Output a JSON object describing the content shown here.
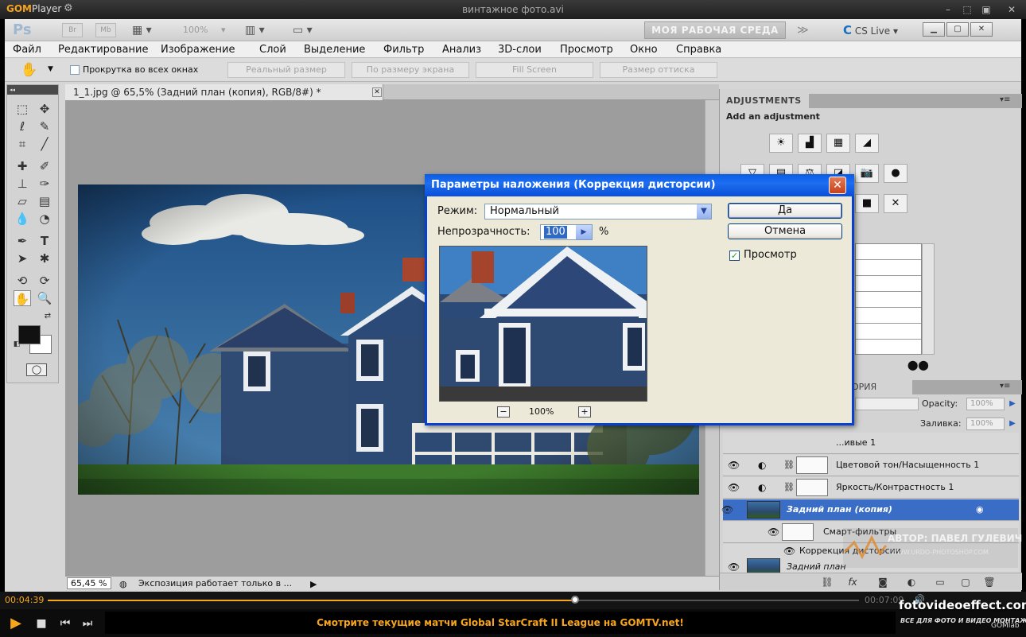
{
  "player": {
    "logo_gom": "GOM",
    "logo_player": "Player",
    "filename": "винтажное фото.avi",
    "current_time": "00:04:39",
    "total_time": "00:07:09",
    "progress_fraction": 0.65,
    "ticker": "Смотрите текущие матчи Global StarCraft II League на GOMTV.net!",
    "brand": "GOMlab"
  },
  "photoshop": {
    "app_logo": "Ps",
    "zoom_level": "100%",
    "workspace_button": "МОЯ РАБОЧАЯ СРЕДА",
    "cs_live": "CS Live",
    "menu": [
      "Файл",
      "Редактирование",
      "Изображение",
      "Слой",
      "Выделение",
      "Фильтр",
      "Анализ",
      "3D-слои",
      "Просмотр",
      "Окно",
      "Справка"
    ],
    "options": {
      "scroll_all_label": "Прокрутка во всех окнах",
      "buttons": [
        "Реальный размер",
        "По размеру экрана",
        "Fill Screen",
        "Размер оттиска"
      ]
    },
    "document": {
      "tab_title": "1_1.jpg @ 65,5% (Задний план (копия), RGB/8#) *",
      "zoom": "65,45 %",
      "status": "Экспозиция работает только в ..."
    },
    "adjustments": {
      "tab": "ADJUSTMENTS",
      "title": "Add an adjustment"
    },
    "layers": {
      "tab_partial": "ОРИЯ",
      "opacity_label": "Opacity:",
      "opacity_value": "100%",
      "fill_label": "Заливка:",
      "fill_value": "100%",
      "items": [
        {
          "name": "...ивые 1"
        },
        {
          "name": "Цветовой тон/Насыщенность 1"
        },
        {
          "name": "Яркость/Контрастность 1"
        },
        {
          "name": "Задний план (копия)"
        },
        {
          "name": "Смарт-фильтры"
        },
        {
          "name": "Коррекция дисторсии"
        },
        {
          "name": "Задний план"
        }
      ]
    }
  },
  "dialog": {
    "title": "Параметры наложения (Коррекция дисторсии)",
    "mode_label": "Режим:",
    "mode_value": "Нормальный",
    "opacity_label": "Непрозрачность:",
    "opacity_value": "100",
    "opacity_unit": "%",
    "ok_button": "Да",
    "cancel_button": "Отмена",
    "preview_label": "Просмотр",
    "preview_checked": true,
    "preview_zoom": "100%"
  },
  "watermark": {
    "author": "АВТОР: ПАВЕЛ ГУЛЕВИЧ",
    "site_small": "WWW.URDO-PHOTOSHOP.COM",
    "site_logo": "fotovideoeffect.com",
    "site_tagline": "ВСЕ ДЛЯ ФОТО И ВИДЕО МОНТАЖА!"
  },
  "colors": {
    "gom_accent": "#f7a51c",
    "xp_title_blue": "#0a5ce6",
    "selection_blue": "#3a6ec6"
  }
}
